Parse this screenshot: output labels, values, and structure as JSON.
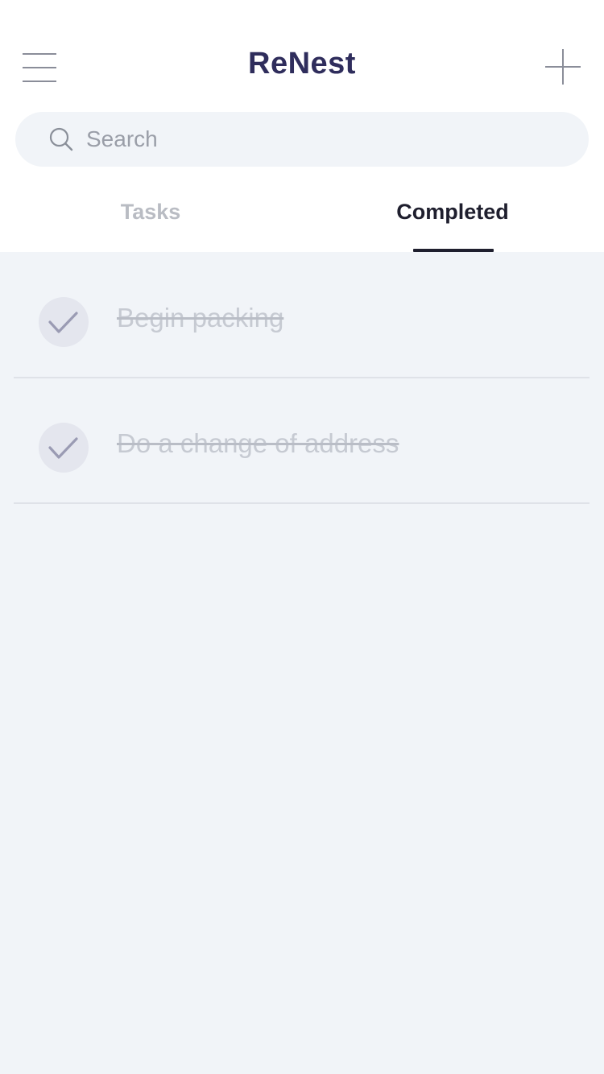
{
  "header": {
    "title": "ReNest",
    "menu_icon": "hamburger-menu-icon",
    "add_icon": "plus-icon"
  },
  "search": {
    "placeholder": "Search",
    "value": "",
    "icon": "search-icon"
  },
  "tabs": [
    {
      "label": "Tasks",
      "active": false
    },
    {
      "label": "Completed",
      "active": true
    }
  ],
  "completed_tasks": [
    {
      "label": "Begin packing",
      "done": true
    },
    {
      "label": "Do a change of address",
      "done": true
    }
  ],
  "colors": {
    "title": "#2f2d5c",
    "active_tab": "#1f1f2e",
    "inactive_tab": "#b9bcc3",
    "content_background": "#f1f4f8",
    "completed_text": "#c6cad2",
    "check_mark": "#9a9bb3"
  }
}
